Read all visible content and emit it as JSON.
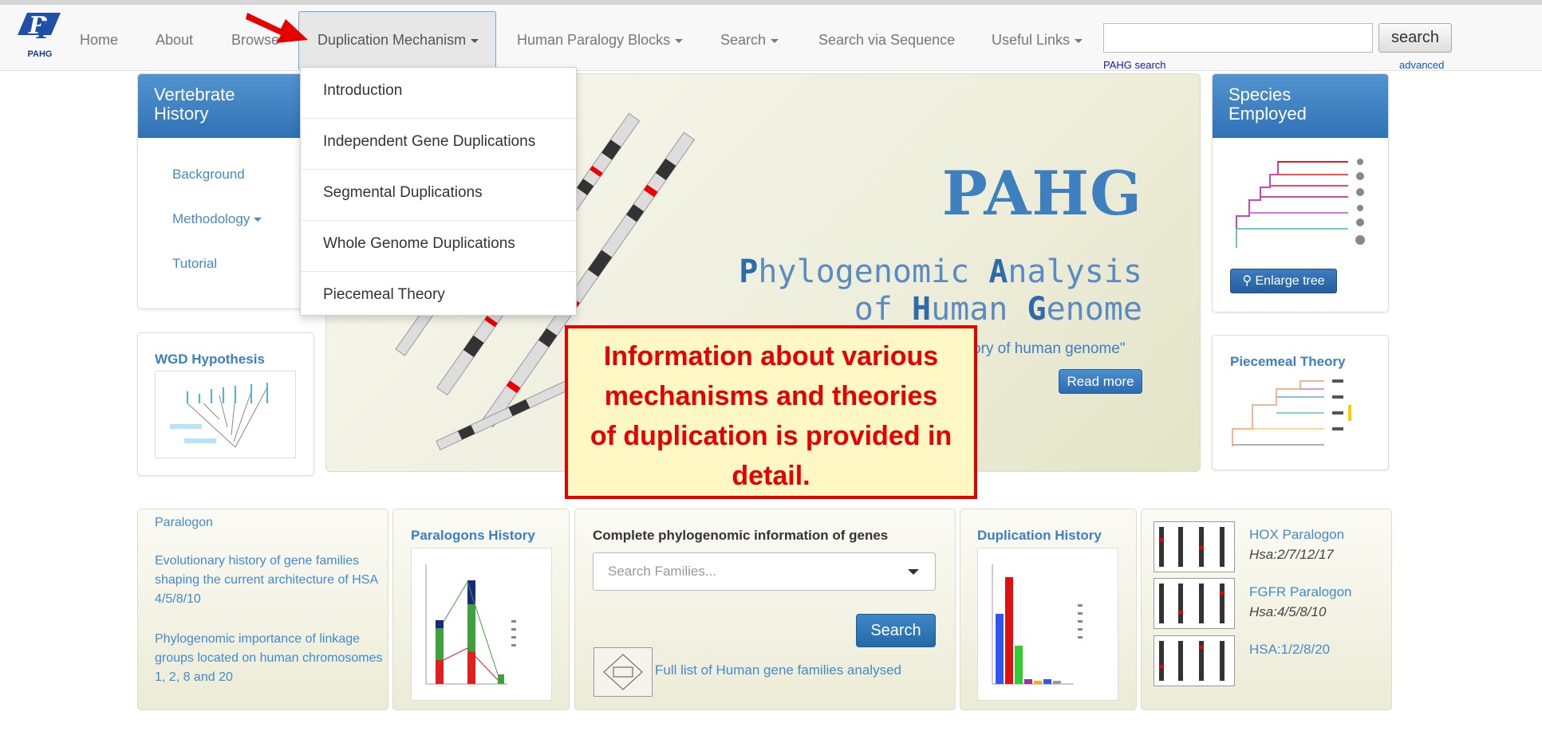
{
  "navbar": {
    "logo_text": "PAHG",
    "items": [
      {
        "label": "Home"
      },
      {
        "label": "About"
      },
      {
        "label": "Browse"
      },
      {
        "label": "Duplication Mechanism"
      },
      {
        "label": "Human Paralogy Blocks"
      },
      {
        "label": "Search"
      },
      {
        "label": "Search via Sequence"
      },
      {
        "label": "Useful Links"
      }
    ],
    "search_button": "search",
    "search_value": "",
    "pahg_search": "PAHG search",
    "advanced": "advanced"
  },
  "dropdown": {
    "items": [
      {
        "label": "Introduction"
      },
      {
        "label": "Independent Gene Duplications"
      },
      {
        "label": "Segmental Duplications"
      },
      {
        "label": "Whole Genome Duplications"
      },
      {
        "label": "Piecemeal Theory"
      }
    ]
  },
  "left_panel": {
    "title_line1": "Vertebrate",
    "title_line2": "History",
    "links": [
      {
        "label": "Background"
      },
      {
        "label": "Methodology"
      },
      {
        "label": "Tutorial"
      }
    ]
  },
  "wgd": {
    "title": "WGD Hypothesis"
  },
  "hero": {
    "title": "PAHG",
    "line1": {
      "c1": "P",
      "r1": "hylogenomic ",
      "c2": "A",
      "r2": "nalysis"
    },
    "line2": {
      "r0": "of ",
      "c1": "H",
      "r1": "uman ",
      "c2": "G",
      "r2": "enome"
    },
    "quote": "ory of human genome\"",
    "read_more": "Read more"
  },
  "callout": {
    "lines": [
      "Information about various",
      "mechanisms and theories",
      "of duplication is provided in",
      "detail."
    ]
  },
  "species": {
    "title_line1": "Species",
    "title_line2": "Employed",
    "enlarge": "Enlarge tree"
  },
  "piecemeal": {
    "title": "Piecemeal Theory"
  },
  "paralogon_panel": {
    "heading": "Paralogon",
    "link1": "Evolutionary history of gene families shaping the current architecture of HSA 4/5/8/10",
    "link2": "Phylogenomic importance of linkage groups located on human chromosomes 1, 2, 8 and 20"
  },
  "paralogons_history": {
    "title": "Paralogons History"
  },
  "families": {
    "title": "Complete phylogenomic information of genes",
    "placeholder": "Search Families...",
    "button": "Search",
    "list_link": "Full list of Human gene families analysed"
  },
  "duplication_history": {
    "title": "Duplication History"
  },
  "hox_panel": {
    "items": [
      {
        "label": "HOX Paralogon",
        "sub": "Hsa:2/7/12/17"
      },
      {
        "label": "FGFR Paralogon",
        "sub": "Hsa:4/5/8/10"
      },
      {
        "label": "HSA:1/2/8/20",
        "sub": ""
      }
    ]
  },
  "colors": {
    "accent": "#428bca",
    "panel_head": "#3a7fc1",
    "callout_red": "#e60000",
    "callout_bg": "#fff8c4"
  }
}
